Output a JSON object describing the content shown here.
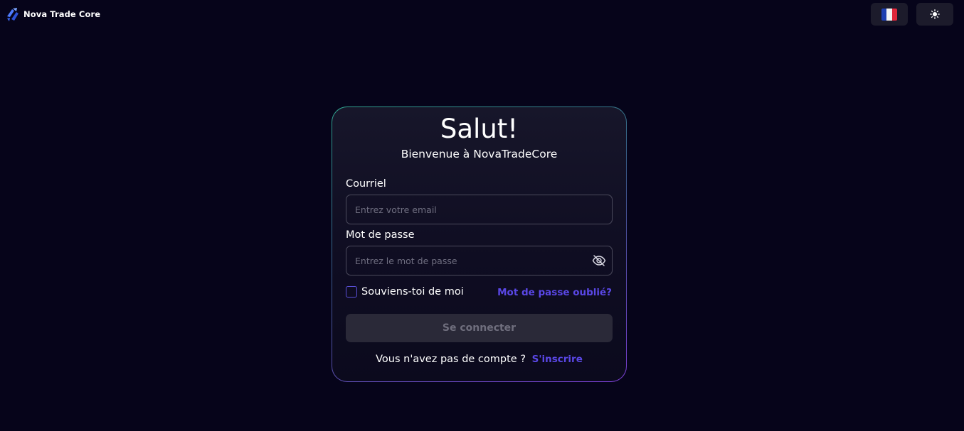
{
  "header": {
    "brand_name": "Nova Trade Core",
    "logo_icon": "nova-logo-icon",
    "language_button_icon": "french-flag-icon",
    "theme_button_icon": "sun-icon"
  },
  "login": {
    "title": "Salut!",
    "subtitle": "Bienvenue à NovaTradeCore",
    "email_label": "Courriel",
    "email_placeholder": "Entrez votre email",
    "email_value": "",
    "password_label": "Mot de passe",
    "password_placeholder": "Entrez le mot de passe",
    "password_value": "",
    "password_toggle_icon": "eye-off-icon",
    "remember_label": "Souviens-toi de moi",
    "remember_checked": false,
    "forgot_link": "Mot de passe oublié?",
    "submit_label": "Se connecter",
    "no_account_text": "Vous n'avez pas de compte ?",
    "signup_link": "S'inscrire"
  },
  "colors": {
    "background": "#06041a",
    "accent": "#5a47e6",
    "card_border_start": "#2fa58f",
    "card_border_end": "#7b3fd4",
    "button_disabled_bg": "#2a2938"
  }
}
